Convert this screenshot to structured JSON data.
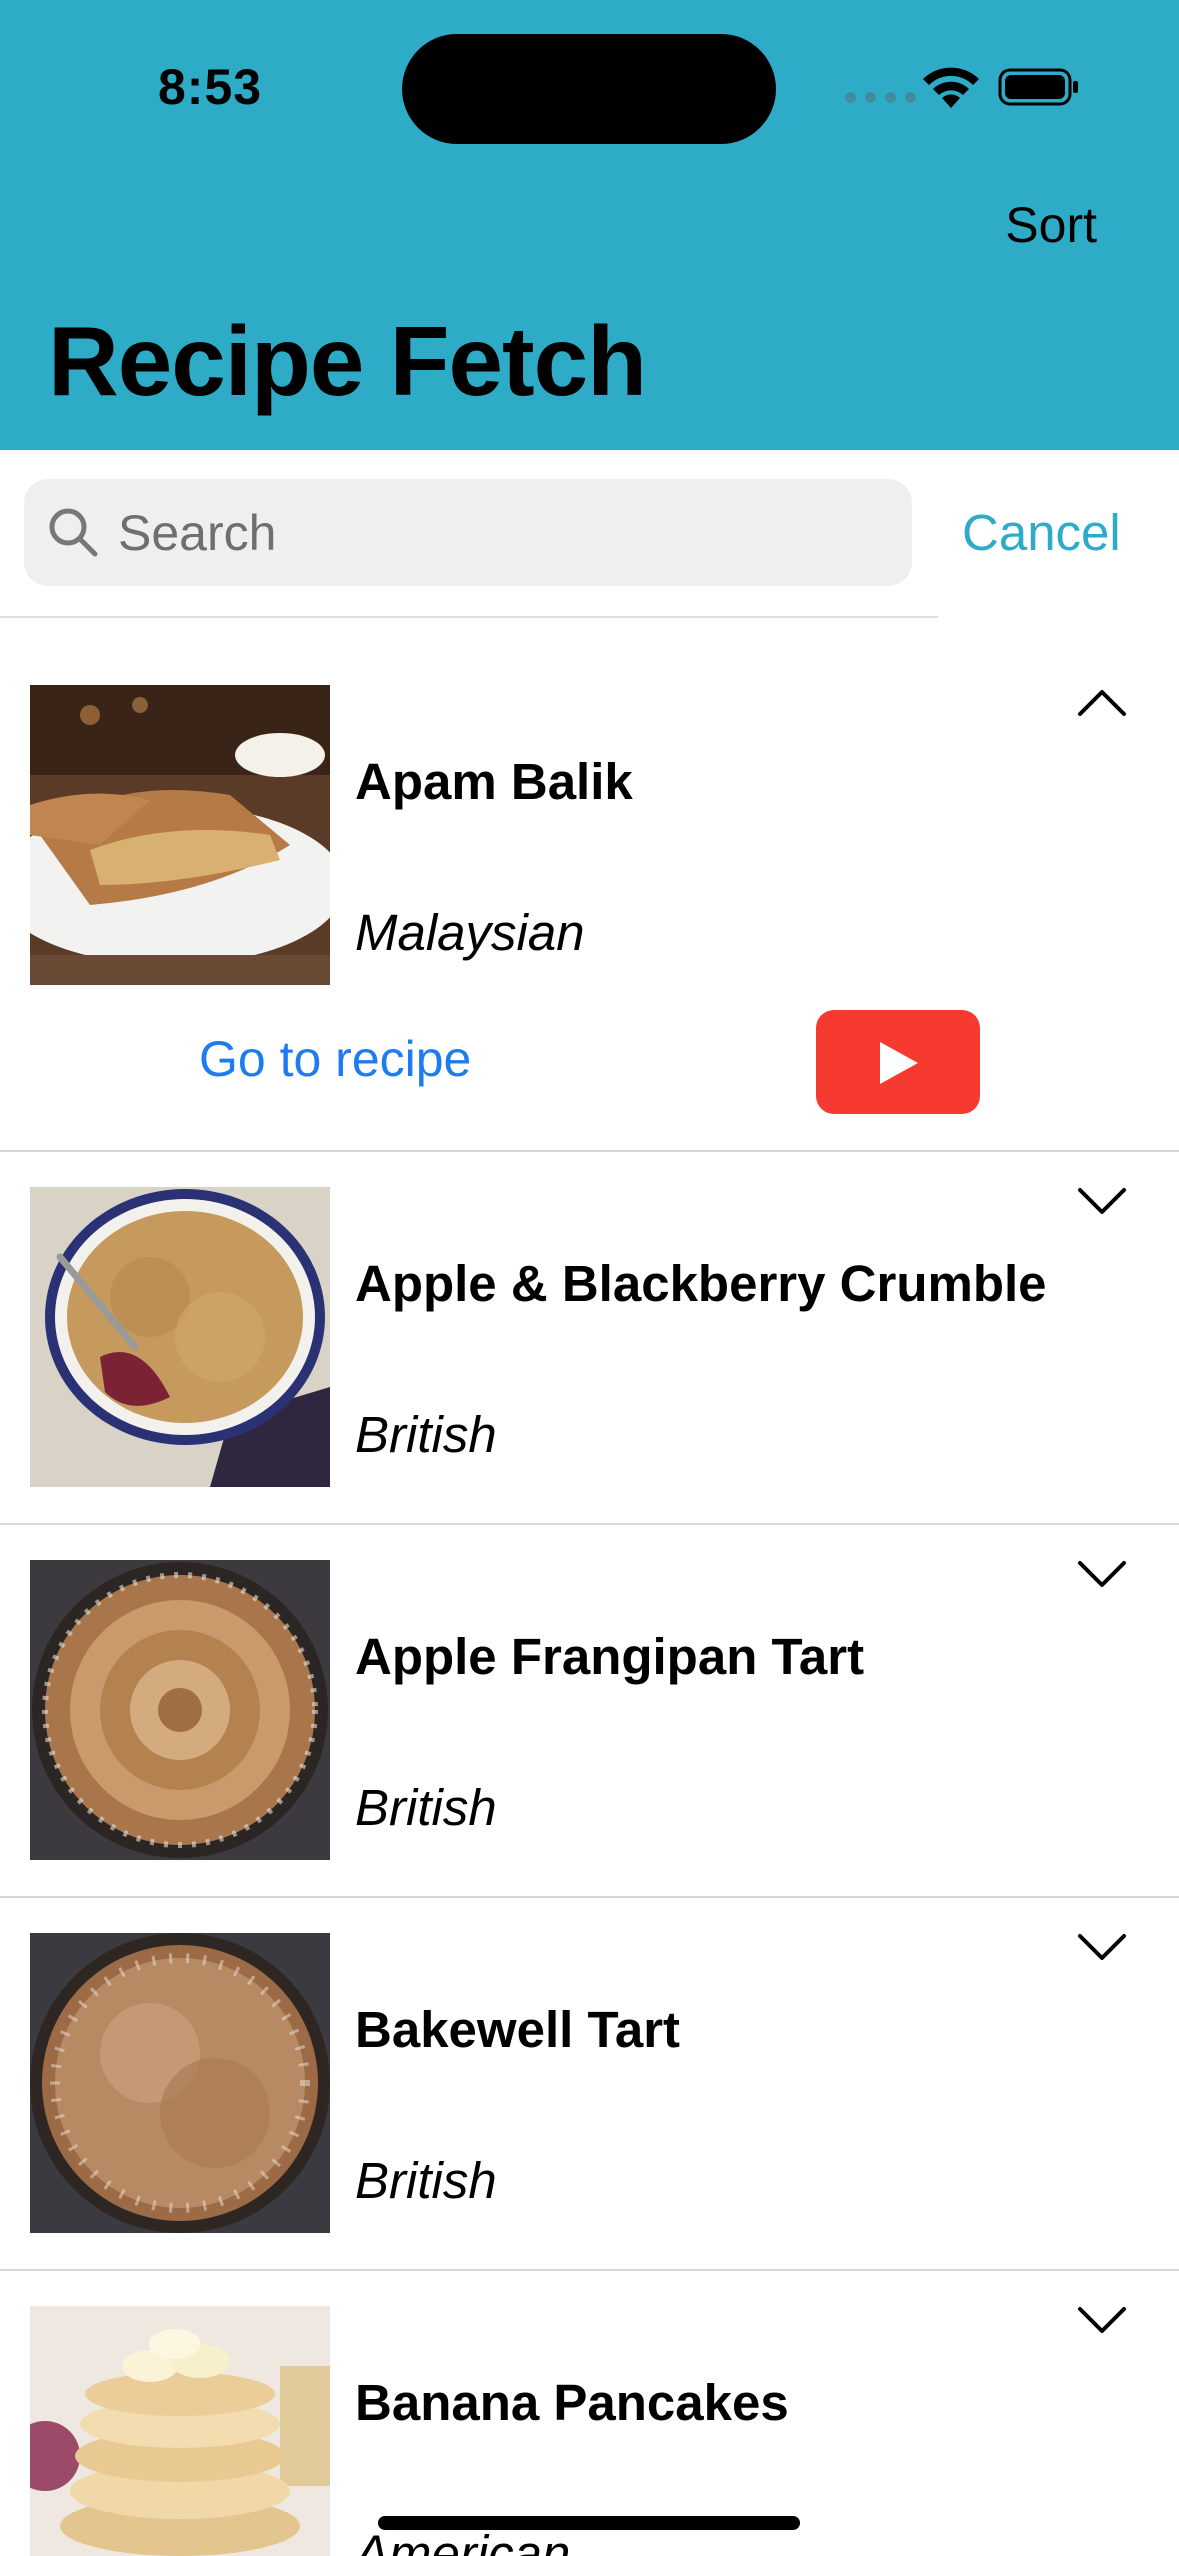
{
  "status": {
    "time": "8:53"
  },
  "header": {
    "sort_label": "Sort",
    "title": "Recipe Fetch",
    "background_color": "#2EACC7"
  },
  "search": {
    "placeholder": "Search",
    "value": "",
    "cancel_label": "Cancel"
  },
  "recipes": [
    {
      "name": "Apam Balik",
      "cuisine": "Malaysian",
      "expanded": true,
      "go_to_recipe_label": "Go to recipe"
    },
    {
      "name": "Apple & Blackberry Crumble",
      "cuisine": "British",
      "expanded": false
    },
    {
      "name": "Apple Frangipan Tart",
      "cuisine": "British",
      "expanded": false
    },
    {
      "name": "Bakewell Tart",
      "cuisine": "British",
      "expanded": false
    },
    {
      "name": "Banana Pancakes",
      "cuisine": "American",
      "expanded": false
    }
  ],
  "icons": {
    "search": "search-icon",
    "expanded": "chevron-up-icon",
    "collapsed": "chevron-down-icon",
    "video": "youtube-play-icon"
  },
  "colors": {
    "link": "#1E7CF0",
    "youtube": "#F63A30",
    "cancel": "#2EACC7"
  }
}
